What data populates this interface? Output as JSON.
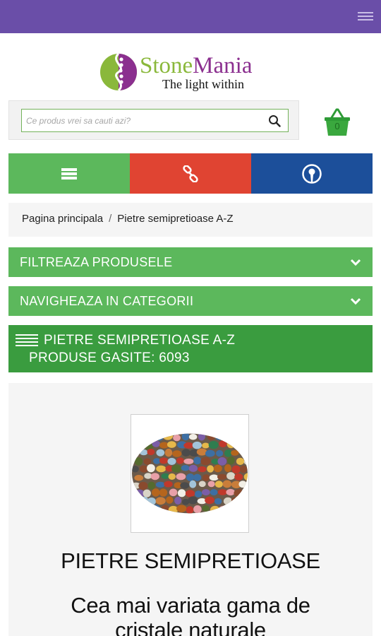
{
  "brand": {
    "name_part1": "Stone",
    "name_part2": "Mania",
    "tagline": "The light within"
  },
  "search": {
    "placeholder": "Ce produs vrei sa cauti azi?"
  },
  "cart": {
    "count": "0"
  },
  "breadcrumb": {
    "home": "Pagina principala",
    "separator": "/",
    "current": "Pietre semipretioase A-Z"
  },
  "accordions": {
    "filter": "FILTREAZA PRODUSELE",
    "categories": "NAVIGHEAZA IN CATEGORII"
  },
  "category": {
    "title": "PIETRE SEMIPRETIOASE A-Z",
    "count_line": "PRODUSE GASITE: 6093"
  },
  "product": {
    "title": "PIETRE SEMIPRETIOASE",
    "tagline": "Cea mai variata gama de cristale naturale"
  },
  "colors": {
    "topbar": "#6a4ea8",
    "green": "#5cb85c",
    "dark_green": "#3a9c3f",
    "red": "#e04432",
    "blue": "#1c4f9a"
  },
  "icons": {
    "top_menu": "hamburger-icon",
    "search": "search-icon",
    "cart": "basket-icon",
    "menu_button": "list-icon",
    "links_button": "chain-link-icon",
    "account_button": "user-icon",
    "dropdown": "chevron-down-icon",
    "category": "list-icon"
  }
}
